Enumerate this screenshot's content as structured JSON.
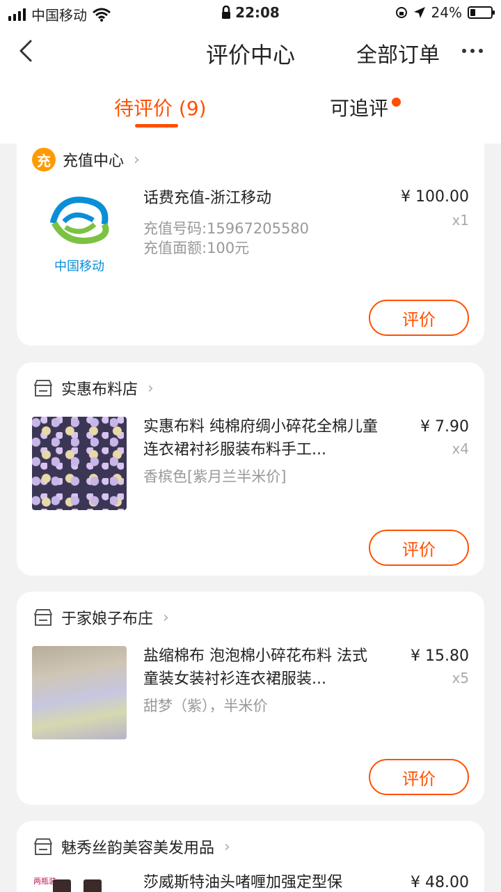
{
  "status_bar": {
    "carrier": "中国移动",
    "time": "22:08",
    "battery": "24%",
    "battery_level": 0.24
  },
  "nav": {
    "title": "评价中心",
    "all_orders": "全部订单"
  },
  "tabs": [
    {
      "label": "待评价 (9)",
      "active": true
    },
    {
      "label": "可追评",
      "has_dot": true
    }
  ],
  "orders": [
    {
      "shop": "充值中心",
      "shop_icon": "recharge-icon",
      "shop_icon_text": "充",
      "product_logo_text": "中国移动",
      "title": "话费充值-浙江移动",
      "sub1": "充值号码:15967205580",
      "sub2": "充值面额:100元",
      "price": "¥ 100.00",
      "qty": "x1",
      "action": "评价"
    },
    {
      "shop": "实惠布料店",
      "shop_icon": "store-icon",
      "title": "实惠布料 纯棉府绸小碎花全棉儿童连衣裙衬衫服装布料手工...",
      "sub1": "香槟色[紫月兰半米价]",
      "price": "¥ 7.90",
      "qty": "x4",
      "action": "评价"
    },
    {
      "shop": "于家娘子布庄",
      "shop_icon": "store-icon",
      "title": "盐缩棉布 泡泡棉小碎花布料 法式 童装女装衬衫连衣裙服装...",
      "sub1": "甜梦（紫），半米价",
      "price": "¥ 15.80",
      "qty": "x5",
      "action": "评价"
    },
    {
      "shop": "魅秀丝韵美容美发用品",
      "shop_icon": "store-icon",
      "thumb_label": "两瓶装",
      "title": "莎威斯特油头啫喱加强定型保",
      "price": "¥ 48.00"
    }
  ],
  "colors": {
    "accent": "#ff5000",
    "background": "#f2f2f2"
  }
}
